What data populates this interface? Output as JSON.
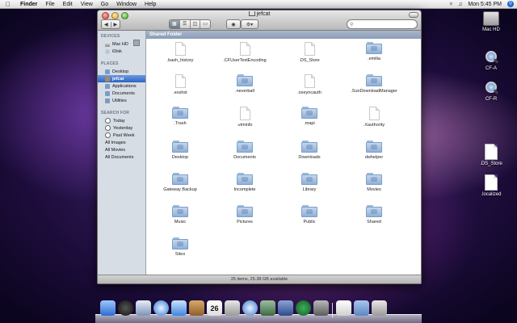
{
  "menubar": {
    "apple": "",
    "items": [
      "Finder",
      "File",
      "Edit",
      "View",
      "Go",
      "Window",
      "Help"
    ],
    "clock": "Mon 5:45 PM",
    "icons": [
      "volume-icon",
      "wifi-icon",
      "spotlight-icon"
    ]
  },
  "desktop": {
    "icons": [
      {
        "label": "Mac HD",
        "icon": "hard-drive-icon"
      },
      {
        "label": "CF-A",
        "icon": "magnifier-icon"
      },
      {
        "label": "CF-R",
        "icon": "magnifier-icon"
      },
      {
        "label": ".DS_Store",
        "icon": "document-icon"
      },
      {
        "label": ".localized",
        "icon": "document-icon"
      }
    ]
  },
  "window": {
    "title": "jefcat",
    "search_placeholder": "",
    "path_title": "Shared Folder",
    "status": "25 items, 25.38 GB available",
    "sidebar": {
      "devices_header": "DEVICES",
      "devices": [
        "Mac HD",
        "iDisk"
      ],
      "places_header": "PLACES",
      "places": [
        "Desktop",
        "jefcat",
        "Applications",
        "Documents",
        "Utilities"
      ],
      "search_header": "SEARCH FOR",
      "searches": [
        "Today",
        "Yesterday",
        "Past Week",
        "All Images",
        "All Movies",
        "All Documents"
      ]
    },
    "items": [
      {
        "name": ".bash_history",
        "kind": "doc"
      },
      {
        "name": ".CFUserTextEncoding",
        "kind": "doc"
      },
      {
        "name": ".DS_Store",
        "kind": "doc"
      },
      {
        "name": ".emilia",
        "kind": "folder"
      },
      {
        "name": ".esshst",
        "kind": "doc"
      },
      {
        "name": ".neverball",
        "kind": "folder"
      },
      {
        "name": ".oxeyncauth",
        "kind": "doc"
      },
      {
        "name": ".SunDownloadManager",
        "kind": "folder"
      },
      {
        "name": ".Trash",
        "kind": "folder"
      },
      {
        "name": ".viminfo",
        "kind": "doc"
      },
      {
        "name": ".mapi",
        "kind": "folder"
      },
      {
        "name": ".Xauthority",
        "kind": "doc"
      },
      {
        "name": "Desktop",
        "kind": "folder"
      },
      {
        "name": "Documents",
        "kind": "folder"
      },
      {
        "name": "Downloads",
        "kind": "folder"
      },
      {
        "name": "dwhelper",
        "kind": "folder"
      },
      {
        "name": "Gateway Backup",
        "kind": "folder"
      },
      {
        "name": "Incomplete",
        "kind": "folder"
      },
      {
        "name": "Library",
        "kind": "folder"
      },
      {
        "name": "Movies",
        "kind": "folder"
      },
      {
        "name": "Music",
        "kind": "folder"
      },
      {
        "name": "Pictures",
        "kind": "folder"
      },
      {
        "name": "Public",
        "kind": "folder"
      },
      {
        "name": "Shared",
        "kind": "folder"
      },
      {
        "name": "Sites",
        "kind": "folder"
      }
    ]
  },
  "dock": {
    "icons": [
      "finder-icon",
      "dashboard-icon",
      "mail-icon",
      "safari-icon",
      "ichat-icon",
      "address-book-icon",
      "ical-icon",
      "preview-icon",
      "itunes-icon",
      "iphoto-icon",
      "spaces-icon",
      "time-machine-icon",
      "system-preferences-icon",
      "documents-stack-icon",
      "downloads-stack-icon",
      "trash-icon"
    ],
    "calendar_day": "26"
  }
}
